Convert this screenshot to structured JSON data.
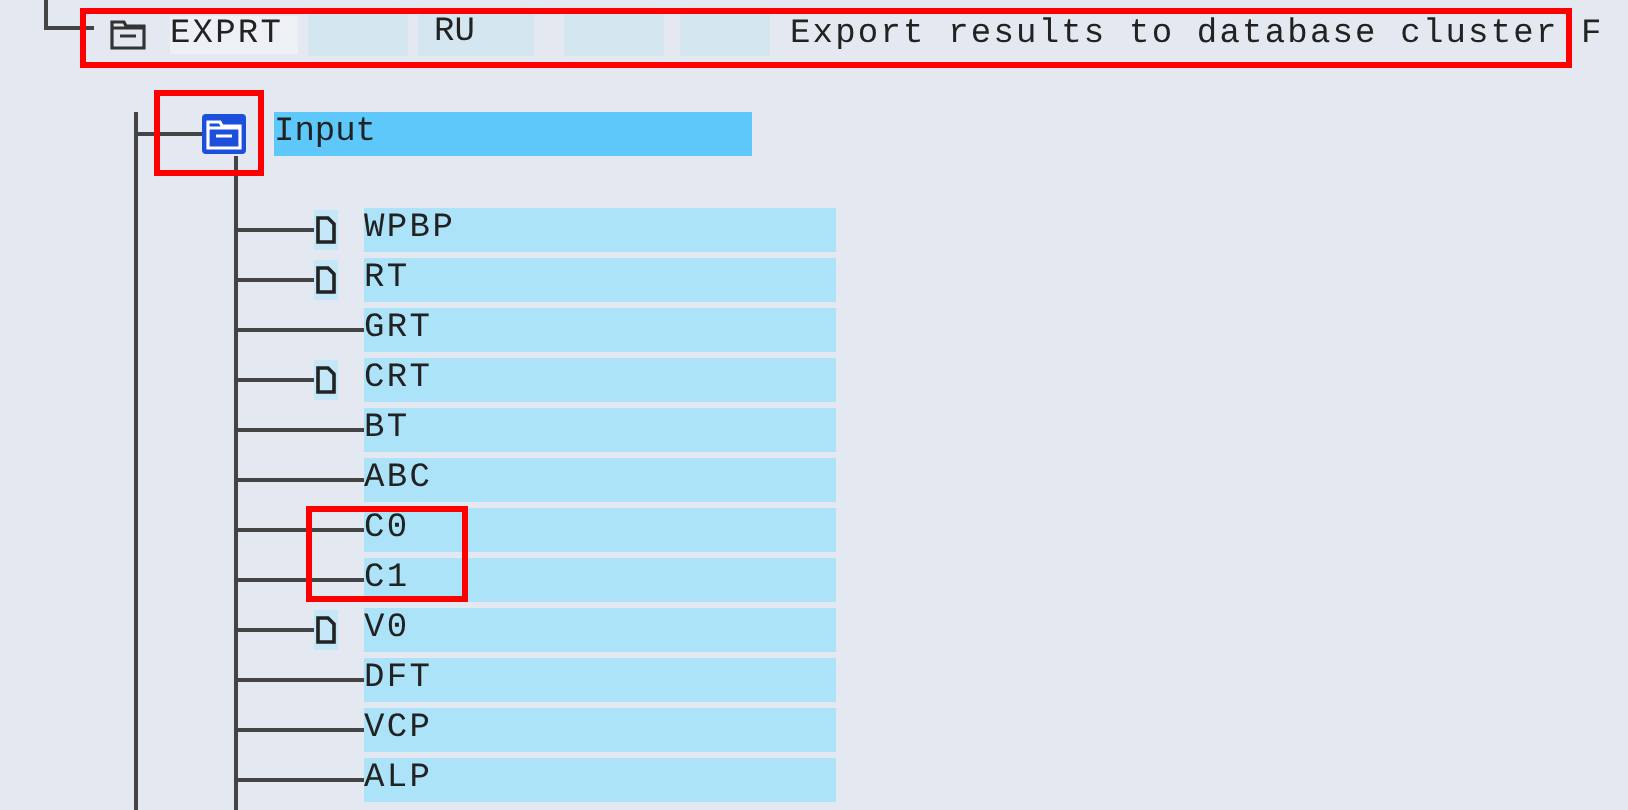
{
  "root": {
    "name": "EXPRT",
    "code": "RU",
    "description": "Export results to database cluster F",
    "marked": true
  },
  "input": {
    "label": "Input",
    "selected": true,
    "marked": true
  },
  "children": [
    {
      "label": "WPBP",
      "kind": "table",
      "marked": false
    },
    {
      "label": "RT",
      "kind": "table",
      "marked": false
    },
    {
      "label": "GRT",
      "kind": "plain",
      "marked": false
    },
    {
      "label": "CRT",
      "kind": "table",
      "marked": false
    },
    {
      "label": "BT",
      "kind": "plain",
      "marked": false
    },
    {
      "label": "ABC",
      "kind": "plain",
      "marked": false
    },
    {
      "label": "C0",
      "kind": "plain",
      "marked": true
    },
    {
      "label": "C1",
      "kind": "plain",
      "marked": true
    },
    {
      "label": "V0",
      "kind": "table",
      "marked": false
    },
    {
      "label": "DFT",
      "kind": "plain",
      "marked": false
    },
    {
      "label": "VCP",
      "kind": "plain",
      "marked": false
    },
    {
      "label": "ALP",
      "kind": "plain",
      "marked": false
    }
  ]
}
